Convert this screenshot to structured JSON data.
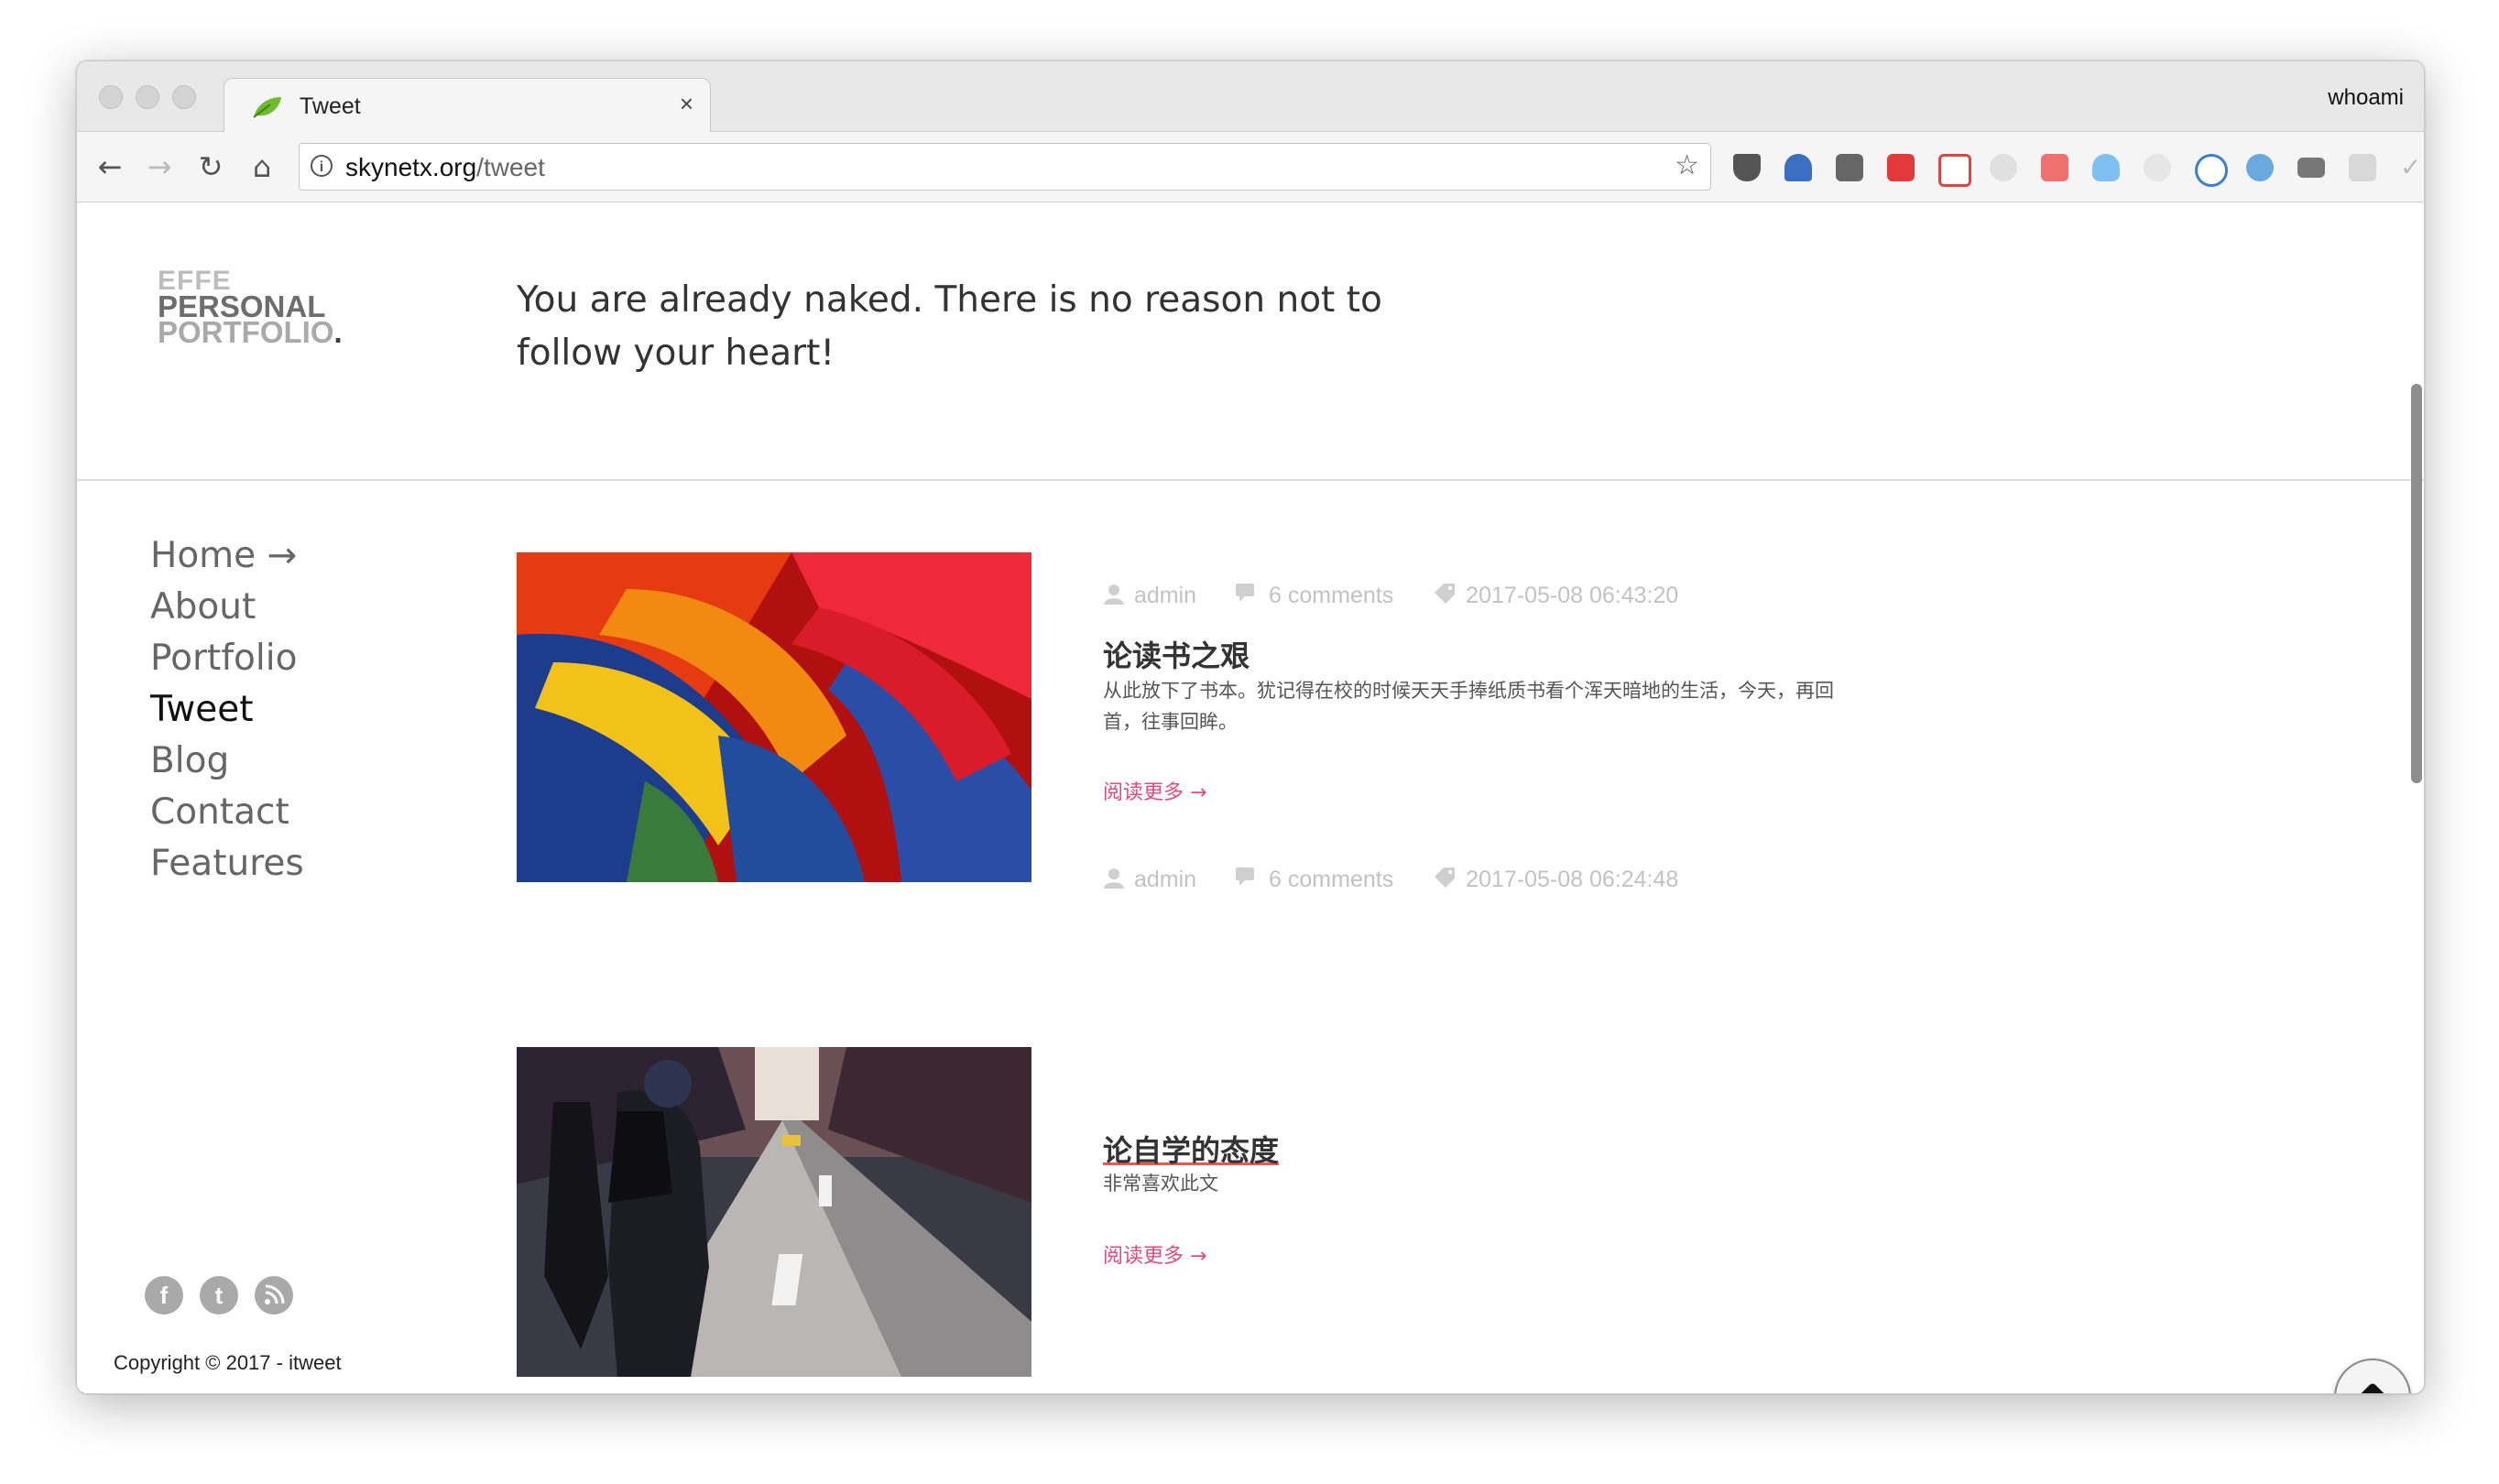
{
  "browser": {
    "tab_title": "Tweet",
    "tab_close": "×",
    "profile_name": "whoami",
    "url_host": "skynetx.org",
    "url_path": "/tweet",
    "star": "☆",
    "extensions": [
      "pocket-icon",
      "y-icon",
      "evernote-icon",
      "fe-icon",
      "plus-icon",
      "gear-icon",
      "red-icon",
      "cloud-icon",
      "shield-icon",
      "moon-icon",
      "compass-icon",
      "mail-icon",
      "qr-icon",
      "check-icon",
      "upload-icon"
    ]
  },
  "site": {
    "logo_line1": "EFFE",
    "logo_line2": "PERSONAL",
    "logo_line3": "PORTFOLIO",
    "logo_dot": ".",
    "tagline": "You are already naked. There is no reason not to follow your heart!",
    "nav": [
      "Home →",
      "About",
      "Portfolio",
      "Tweet",
      "Blog",
      "Contact",
      "Features"
    ],
    "nav_active": "Tweet",
    "social": [
      "f",
      "t",
      "rss"
    ],
    "copyright": "Copyright © 2017 - itweet"
  },
  "posts": [
    {
      "author": "admin",
      "comments": "6 comments",
      "date": "2017-05-08 06:43:20",
      "title": "论读书之艰",
      "excerpt": "从此放下了书本。犹记得在校的时候天天手捧纸质书看个浑天暗地的生活，今天，再回首，往事回眸。",
      "read_more": "阅读更多 →"
    },
    {
      "author": "admin",
      "comments": "6 comments",
      "date": "2017-05-08 06:24:48",
      "title": "论自学的态度",
      "excerpt": "非常喜欢此文",
      "read_more": "阅读更多 →"
    }
  ],
  "colors": {
    "accent_link": "#e04b82",
    "meta_gray": "#c2c2c2"
  }
}
